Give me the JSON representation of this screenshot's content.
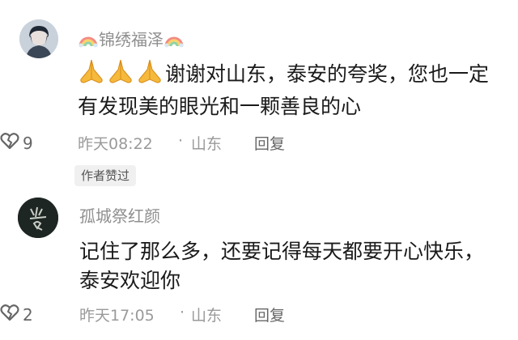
{
  "comments": [
    {
      "username": "锦绣福泽",
      "username_decor_icon": "rainbow-icon",
      "prefix_icons": [
        "praying-hands-icon",
        "praying-hands-icon",
        "praying-hands-icon"
      ],
      "text": "谢谢对山东，泰安的夸奖，您也一定有发现美的眼光和一颗善良的心",
      "time": "昨天08:22",
      "separator": "·",
      "location": "山东",
      "reply_label": "回复",
      "like_count": "9",
      "badge": "作者赞过"
    },
    {
      "username": "孤城祭红颜",
      "text": "记住了那么多，还要记得每天都要开心快乐，   泰安欢迎你",
      "time": "昨天17:05",
      "separator": "·",
      "location": "山东",
      "reply_label": "回复",
      "like_count": "2"
    }
  ],
  "colors": {
    "username": "#8f8f8f",
    "meta": "#9a9a9a",
    "text": "#1a1a1a",
    "badge_bg": "#f0f0f0"
  }
}
